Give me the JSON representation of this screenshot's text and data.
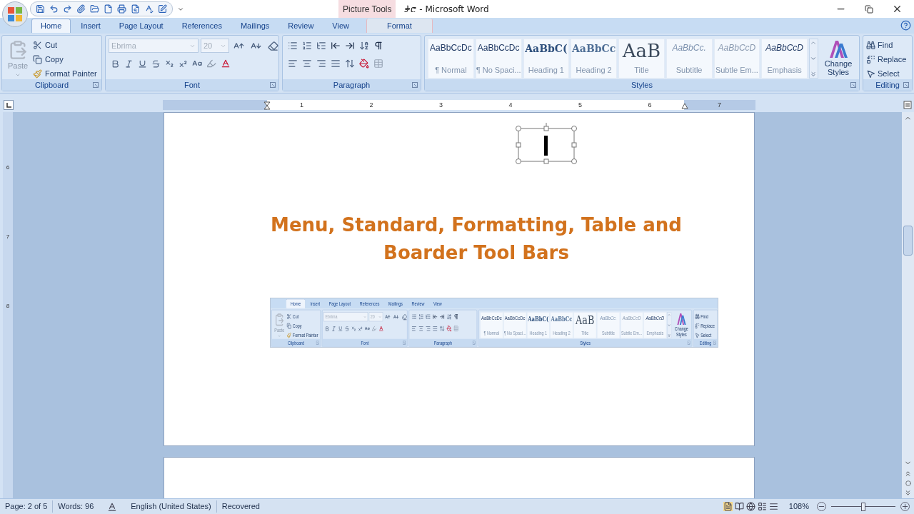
{
  "title_bar": {
    "contextual_tab": "Picture Tools",
    "title": "ቃሮ - Microsoft Word"
  },
  "ribbon": {
    "tabs": [
      {
        "label": "Home",
        "selected": true
      },
      {
        "label": "Insert",
        "selected": false
      },
      {
        "label": "Page Layout",
        "selected": false
      },
      {
        "label": "References",
        "selected": false
      },
      {
        "label": "Mailings",
        "selected": false
      },
      {
        "label": "Review",
        "selected": false
      },
      {
        "label": "View",
        "selected": false
      },
      {
        "label": "Format",
        "selected": false,
        "kind": "contextual"
      }
    ],
    "clipboard": {
      "paste": "Paste",
      "cut": "Cut",
      "copy": "Copy",
      "format_painter": "Format Painter",
      "label": "Clipboard"
    },
    "font": {
      "name": "Ebrima",
      "size": "20",
      "label": "Font"
    },
    "paragraph": {
      "label": "Paragraph"
    },
    "styles": {
      "items": [
        {
          "sample": "AaBbCcDc",
          "name": "¶ Normal",
          "kind": "normal"
        },
        {
          "sample": "AaBbCcDc",
          "name": "¶ No Spaci...",
          "kind": "normal"
        },
        {
          "sample": "AaBbC(",
          "name": "Heading 1",
          "kind": "heading1"
        },
        {
          "sample": "AaBbCc",
          "name": "Heading 2",
          "kind": "heading2"
        },
        {
          "sample": "AaB",
          "name": "Title",
          "kind": "title"
        },
        {
          "sample": "AaBbCc.",
          "name": "Subtitle",
          "kind": "subtitle"
        },
        {
          "sample": "AaBbCcD",
          "name": "Subtle Em...",
          "kind": "subtle"
        },
        {
          "sample": "AaBbCcD",
          "name": "Emphasis",
          "kind": "emphasis"
        }
      ],
      "change": "Change Styles",
      "label": "Styles"
    },
    "editing": {
      "find": "Find",
      "replace": "Replace",
      "select": "Select",
      "label": "Editing"
    }
  },
  "ruler": {
    "numbers": [
      "1",
      "2",
      "3",
      "4",
      "5",
      "6",
      "7"
    ]
  },
  "vertical_ruler": {
    "numbers": [
      "6",
      "7",
      "8"
    ]
  },
  "document": {
    "heading": [
      "Menu, Standard, Formatting, Table and",
      "Boarder Tool Bars"
    ],
    "embedded_ribbon": {
      "tabs": [
        {
          "label": "Home",
          "selected": true
        },
        {
          "label": "Insert",
          "selected": false
        },
        {
          "label": "Page Layout",
          "selected": false
        },
        {
          "label": "References",
          "selected": false
        },
        {
          "label": "Mailings",
          "selected": false
        },
        {
          "label": "Review",
          "selected": false
        },
        {
          "label": "View",
          "selected": false
        }
      ],
      "clipboard": {
        "paste": "Paste",
        "cut": "Cut",
        "copy": "Copy",
        "format_painter": "Format Painter",
        "label": "Clipboard"
      },
      "font": {
        "name": "Ebrima",
        "size": "20",
        "label": "Font"
      },
      "paragraph": {
        "label": "Paragraph"
      },
      "styles": {
        "items": [
          {
            "sample": "AaBbCcDc",
            "name": "¶ Normal",
            "kind": "normal"
          },
          {
            "sample": "AaBbCcDc",
            "name": "¶ No Spaci...",
            "kind": "normal"
          },
          {
            "sample": "AaBbC(",
            "name": "Heading 1",
            "kind": "heading1"
          },
          {
            "sample": "AaBbCc",
            "name": "Heading 2",
            "kind": "heading2"
          },
          {
            "sample": "AaB",
            "name": "Title",
            "kind": "title"
          },
          {
            "sample": "AaBbCc.",
            "name": "Subtitle",
            "kind": "subtitle"
          },
          {
            "sample": "AaBbCcD",
            "name": "Subtle Em...",
            "kind": "subtle"
          },
          {
            "sample": "AaBbCcD",
            "name": "Emphasis",
            "kind": "emphasis"
          }
        ],
        "change": "Change Styles",
        "label": "Styles"
      },
      "editing": {
        "find": "Find",
        "replace": "Replace",
        "select": "Select",
        "label": "Editing"
      }
    }
  },
  "status_bar": {
    "page": "Page: 2 of 5",
    "words": "Words: 96",
    "language": "English (United States)",
    "state": "Recovered",
    "zoom": "108%",
    "zoom_slider": {
      "level": 0.5
    }
  }
}
